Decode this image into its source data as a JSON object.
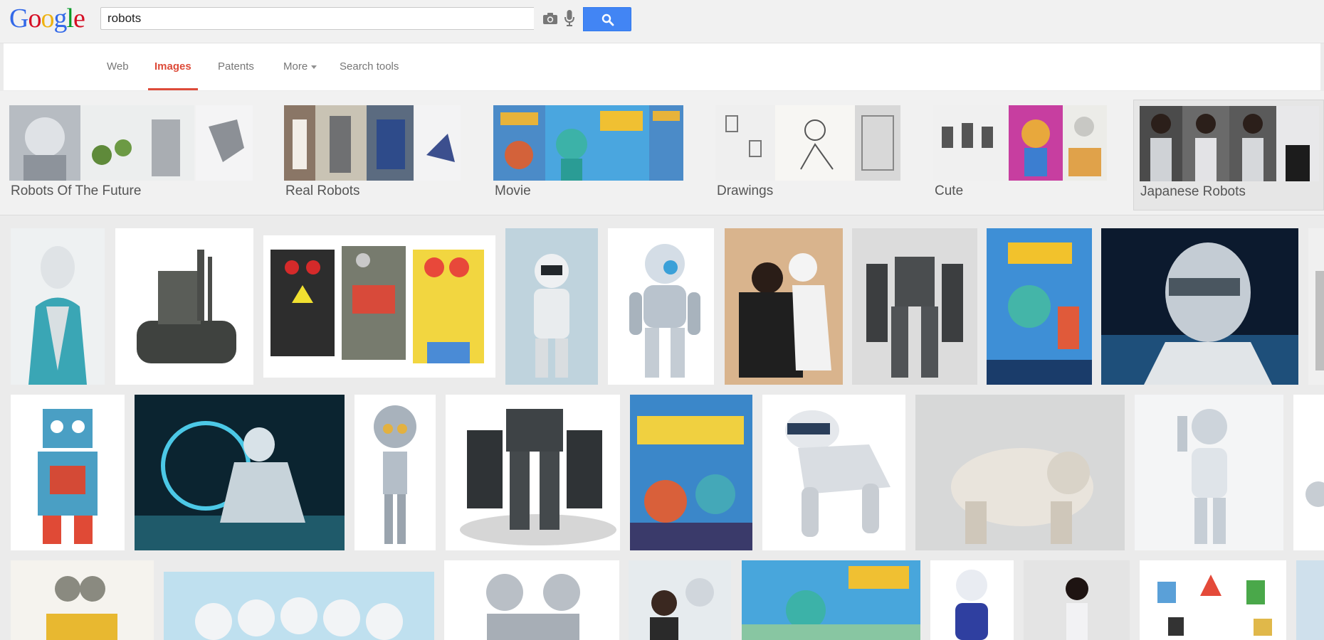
{
  "header": {
    "logo_letters": [
      {
        "ch": "G",
        "color": "#3369e8"
      },
      {
        "ch": "o",
        "color": "#d50f25"
      },
      {
        "ch": "o",
        "color": "#eeb211"
      },
      {
        "ch": "g",
        "color": "#3369e8"
      },
      {
        "ch": "l",
        "color": "#009925"
      },
      {
        "ch": "e",
        "color": "#d50f25"
      }
    ],
    "search_value": "robots"
  },
  "nav": {
    "items": [
      {
        "label": "Web",
        "active": false
      },
      {
        "label": "Images",
        "active": true
      },
      {
        "label": "Patents",
        "active": false
      },
      {
        "label": "More",
        "active": false
      },
      {
        "label": "Search tools",
        "active": false
      }
    ]
  },
  "related": [
    {
      "label": "Robots Of The Future"
    },
    {
      "label": "Real Robots"
    },
    {
      "label": "Movie"
    },
    {
      "label": "Drawings"
    },
    {
      "label": "Cute"
    },
    {
      "label": "Japanese Robots"
    }
  ],
  "colors": {
    "accent_red": "#dd4b39",
    "search_blue": "#4285f4"
  }
}
